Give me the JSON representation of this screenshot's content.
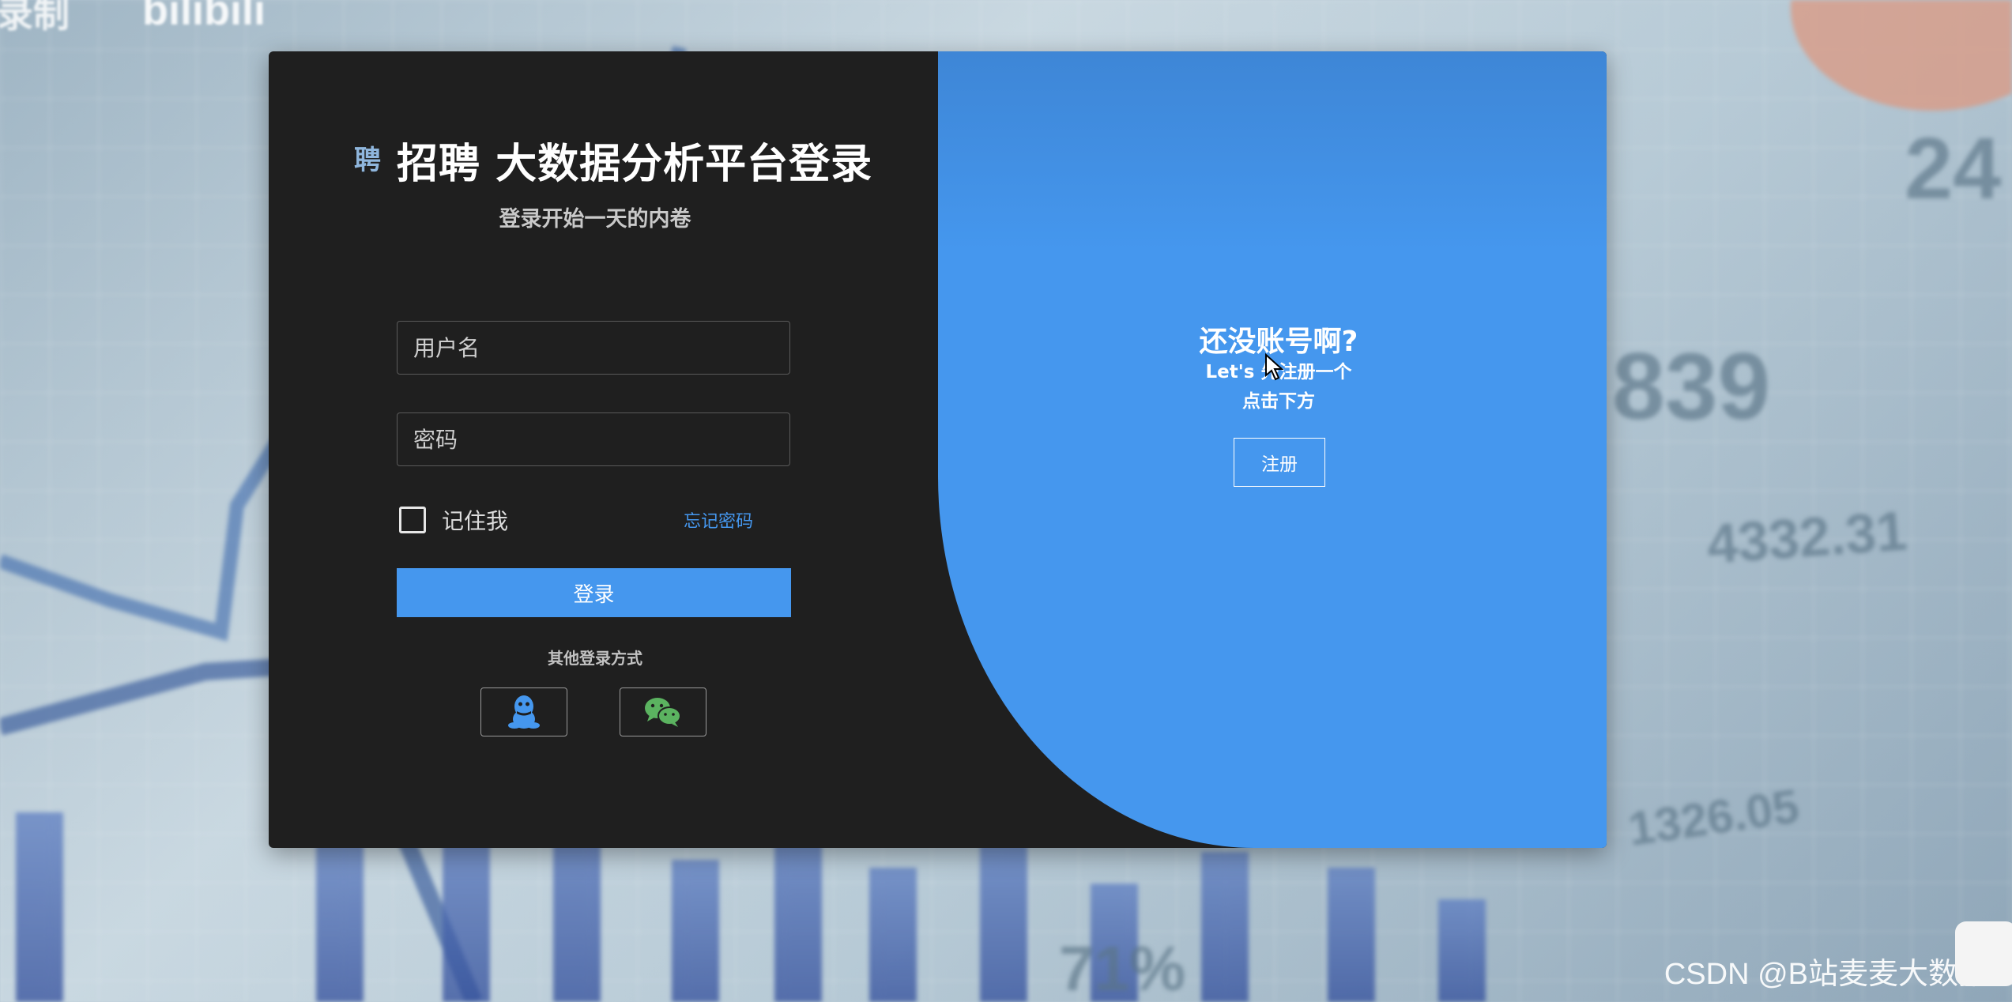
{
  "background": {
    "numbers": [
      "24",
      "839",
      "4332.31",
      "1326.05",
      "71%"
    ],
    "corner_logo": "bilibili",
    "corner_text": "录制"
  },
  "login": {
    "logo_icon": "聘",
    "title": "招聘 大数据分析平台登录",
    "subtitle": "登录开始一天的内卷",
    "username_placeholder": "用户名",
    "password_placeholder": "密码",
    "remember_label": "记住我",
    "forgot_label": "忘记密码",
    "login_label": "登录",
    "other_label": "其他登录方式",
    "social_icons": [
      "qq-icon",
      "wechat-icon"
    ]
  },
  "promo": {
    "title": "还没账号啊?",
    "line1": "Let's 先注册一个",
    "line2": "点击下方",
    "register_label": "注册"
  },
  "watermark": "CSDN @B站麦麦大数据",
  "colors": {
    "accent": "#4597ee",
    "panel_dark": "#1f1f1f",
    "wechat_green": "#5bb360"
  }
}
